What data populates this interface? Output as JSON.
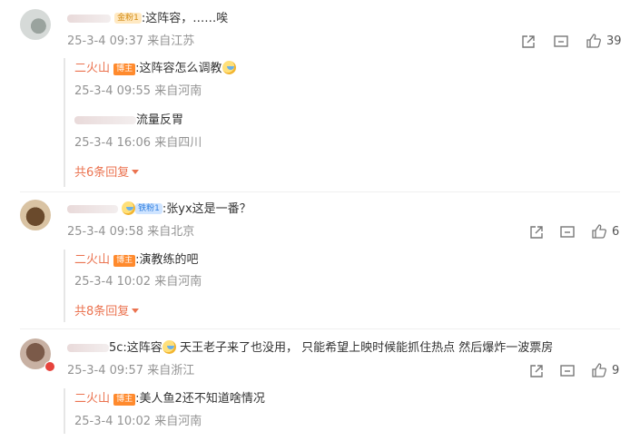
{
  "comments": [
    {
      "fan_badge": "金粉1",
      "text": ":这阵容，……唉",
      "time": "25-3-4 09:37",
      "location": "来自江苏",
      "likes": "39",
      "replies": [
        {
          "author": "二火山",
          "badge": "博主",
          "text": ":这阵容怎么调教",
          "time": "25-3-4 09:55",
          "location": "来自河南"
        },
        {
          "author": "",
          "badge": "",
          "text": "流量反胃",
          "time": "25-3-4 16:06",
          "location": "来自四川"
        }
      ],
      "more_replies": "共6条回复"
    },
    {
      "fan_badge": "铁粉1",
      "text": ":张yx这是一番？",
      "time": "25-3-4 09:58",
      "location": "来自北京",
      "likes": "6",
      "replies": [
        {
          "author": "二火山",
          "badge": "博主",
          "text": ":演教练的吧",
          "time": "25-3-4 10:02",
          "location": "来自河南"
        }
      ],
      "more_replies": "共8条回复"
    },
    {
      "name_fragment": "5c",
      "text_a": ":这阵容",
      "text_b": " 天王老子来了也没用， 只能希望上映时候能抓住热点 然后爆炸一波票房",
      "time": "25-3-4 09:57",
      "location": "来自浙江",
      "likes": "9",
      "replies": [
        {
          "author": "二火山",
          "badge": "博主",
          "text": ":美人鱼2还不知道啥情况",
          "time": "25-3-4 10:02",
          "location": "来自河南"
        }
      ]
    }
  ],
  "icons": [
    "share-icon",
    "comment-icon",
    "like-icon"
  ]
}
